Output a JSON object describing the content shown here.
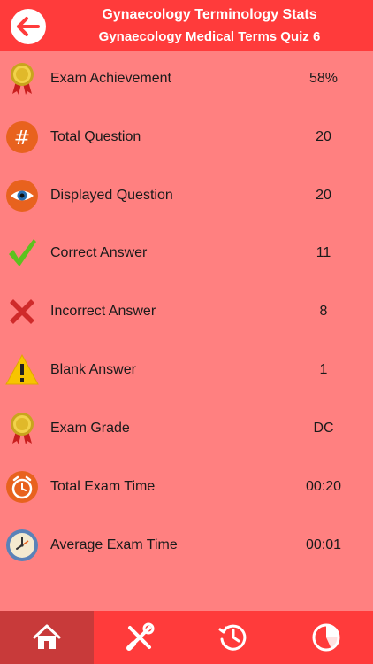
{
  "header": {
    "title": "Gynaecology Terminology Stats",
    "subtitle": "Gynaecology Medical Terms Quiz 6"
  },
  "stats": [
    {
      "label": "Exam Achievement",
      "value": "58%",
      "icon": "award-ribbon-icon"
    },
    {
      "label": "Total Question",
      "value": "20",
      "icon": "hash-icon"
    },
    {
      "label": "Displayed Question",
      "value": "20",
      "icon": "eye-icon"
    },
    {
      "label": "Correct Answer",
      "value": "11",
      "icon": "checkmark-icon"
    },
    {
      "label": "Incorrect Answer",
      "value": "8",
      "icon": "cross-icon"
    },
    {
      "label": "Blank Answer",
      "value": "1",
      "icon": "warning-icon"
    },
    {
      "label": "Exam Grade",
      "value": "DC",
      "icon": "award-ribbon-icon"
    },
    {
      "label": "Total Exam Time",
      "value": "00:20",
      "icon": "alarm-clock-icon"
    },
    {
      "label": "Average Exam Time",
      "value": "00:01",
      "icon": "clock-icon"
    }
  ],
  "tabbar": {
    "items": [
      {
        "icon": "home-icon",
        "active": true
      },
      {
        "icon": "tools-icon",
        "active": false
      },
      {
        "icon": "history-icon",
        "active": false
      },
      {
        "icon": "pie-chart-icon",
        "active": false
      }
    ]
  },
  "colors": {
    "header": "#ff3b3b",
    "background": "#ff8080",
    "tab_active": "#c83a3a"
  }
}
